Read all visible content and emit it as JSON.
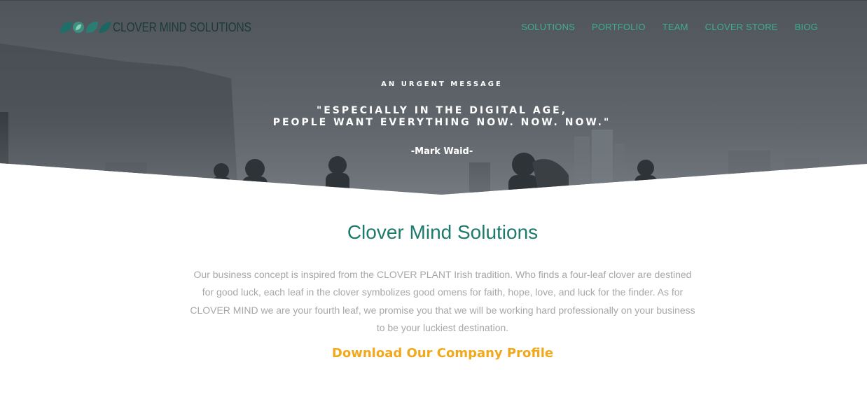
{
  "header": {
    "logo_text": "CLOVER MIND SOLUTIONS",
    "nav": [
      {
        "label": "SOLUTIONS"
      },
      {
        "label": "PORTFOLIO"
      },
      {
        "label": "TEAM"
      },
      {
        "label": "CLOVER STORE"
      },
      {
        "label": "BIOG"
      }
    ]
  },
  "hero": {
    "eyebrow": "AN URGENT MESSAGE",
    "quote_line_1": "\"ESPECIALLY IN THE DIGITAL AGE,",
    "quote_line_2": "PEOPLE WANT EVERYTHING NOW. NOW. NOW.\"",
    "author": "-Mark Waid-"
  },
  "main": {
    "title": "Clover Mind Solutions",
    "body": "Our business concept is inspired from the CLOVER PLANT Irish tradition. Who finds a four-leaf clover are destined for good luck, each leaf in the clover symbolizes good omens for faith, hope, love, and luck for the finder. As for CLOVER MIND we are your fourth leaf, we promise you that we will be working hard professionally on your business to be your luckiest destination.",
    "download_label": "Download Our Company Profile"
  },
  "colors": {
    "brand_green": "#1d7a6d",
    "nav_green": "#3fae8a",
    "accent_orange": "#f0a81c",
    "body_text": "#a7a7a7",
    "hero_overlay": "#545a60"
  },
  "icons": {
    "logo": "clover-leaves-logo-icon"
  }
}
